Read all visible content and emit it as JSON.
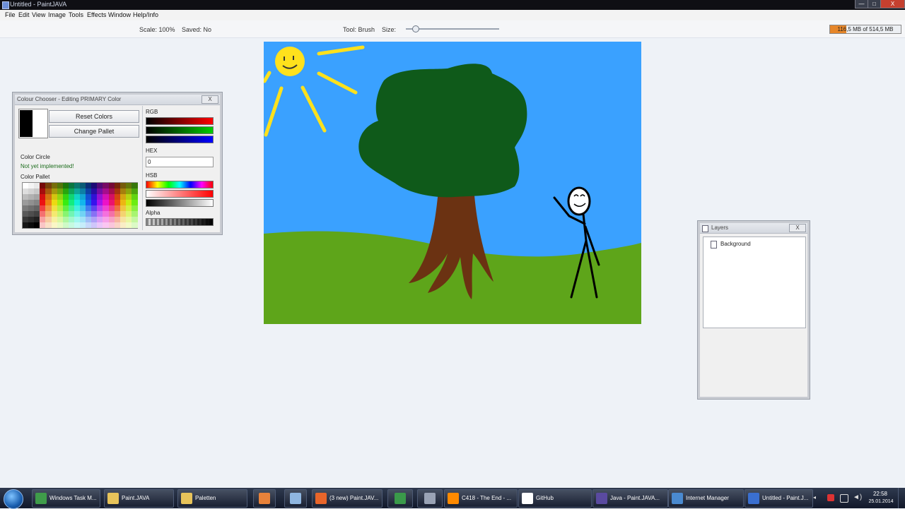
{
  "window": {
    "title": "Untitled - PaintJAVA",
    "minimize": "—",
    "maximize": "□",
    "close": "X"
  },
  "menu": [
    "File",
    "Edit",
    "View",
    "Image",
    "Tools",
    "Effects",
    "Window",
    "Help/Info"
  ],
  "toolbar": {
    "scale": "Scale: 100%",
    "saved": "Saved: No",
    "tool": "Tool: Brush",
    "size_label": "Size:",
    "size_value": 0.1,
    "memory": "116,5 MB of 514,5 MB",
    "memory_fraction": 0.23
  },
  "colour_chooser": {
    "title": "Colour Chooser - Editing PRIMARY Color",
    "close": "X",
    "reset_button": "Reset Colors",
    "change_button": "Change Pallet",
    "rgb_label": "RGB",
    "hex_label": "HEX",
    "hex_value": "0",
    "hsb_label": "HSB",
    "alpha_label": "Alpha",
    "circle_label": "Color Circle",
    "circle_status": "Not yet implemented!",
    "pallet_label": "Color Pallet",
    "colors": {
      "red": "#ff0000",
      "green": "#00cc00",
      "blue": "#0000ff"
    }
  },
  "layers": {
    "title": "Layers",
    "close": "X",
    "items": [
      "Background"
    ]
  },
  "drawing": {
    "sky": "#3aa1ff",
    "grass": "#5ea51a",
    "foliage": "#0f5a1a",
    "trunk": "#6b3212",
    "sun": "#ffe11c"
  },
  "taskbar": {
    "items": [
      {
        "label": "Windows Task M...",
        "icon": "task-manager-icon"
      },
      {
        "label": "Paint.JAVA",
        "icon": "folder-icon"
      },
      {
        "label": "Paletten",
        "icon": "folder-icon"
      },
      {
        "label": "",
        "icon": "media-player-icon"
      },
      {
        "label": "",
        "icon": "notepad-icon"
      },
      {
        "label": "(3 new) Paint.JAV...",
        "icon": "firefox-icon"
      },
      {
        "label": "",
        "icon": "chrome-icon"
      },
      {
        "label": "",
        "icon": "app-icon"
      },
      {
        "label": "C418 - The End - ...",
        "icon": "vlc-icon"
      },
      {
        "label": "GitHub",
        "icon": "github-icon"
      },
      {
        "label": "Java - Paint.JAVA...",
        "icon": "eclipse-icon"
      },
      {
        "label": "Internet Manager",
        "icon": "network-icon"
      },
      {
        "label": "Untitled - Paint.J...",
        "icon": "java-icon"
      }
    ],
    "time": "22:58",
    "date": "25.01.2014"
  }
}
